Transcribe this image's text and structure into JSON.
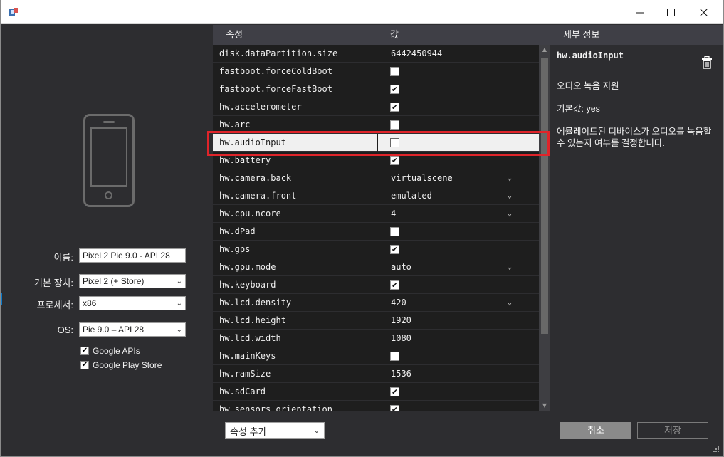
{
  "window": {
    "minimize_glyph": "—",
    "maximize_glyph": "☐",
    "close_glyph": "✕"
  },
  "form": {
    "name_label": "이름:",
    "name_value": "Pixel 2 Pie 9.0 - API 28",
    "base_device_label": "기본 장치:",
    "base_device_value": "Pixel 2 (+ Store)",
    "processor_label": "프로세서:",
    "processor_value": "x86",
    "os_label": "OS:",
    "os_value": "Pie 9.0 – API 28",
    "google_apis_label": "Google APIs",
    "google_play_label": "Google Play Store",
    "google_apis_checked": true,
    "google_play_checked": true
  },
  "grid": {
    "col_property": "속성",
    "col_value": "값",
    "rows": [
      {
        "name": "disk.dataPartition.size",
        "type": "text",
        "value": "6442450944"
      },
      {
        "name": "fastboot.forceColdBoot",
        "type": "check",
        "checked": false
      },
      {
        "name": "fastboot.forceFastBoot",
        "type": "check",
        "checked": true
      },
      {
        "name": "hw.accelerometer",
        "type": "check",
        "checked": true
      },
      {
        "name": "hw.arc",
        "type": "check",
        "checked": false
      },
      {
        "name": "hw.audioInput",
        "type": "check",
        "checked": false,
        "selected": true
      },
      {
        "name": "hw.battery",
        "type": "check",
        "checked": true
      },
      {
        "name": "hw.camera.back",
        "type": "select",
        "value": "virtualscene"
      },
      {
        "name": "hw.camera.front",
        "type": "select",
        "value": "emulated"
      },
      {
        "name": "hw.cpu.ncore",
        "type": "select",
        "value": "4"
      },
      {
        "name": "hw.dPad",
        "type": "check",
        "checked": false
      },
      {
        "name": "hw.gps",
        "type": "check",
        "checked": true
      },
      {
        "name": "hw.gpu.mode",
        "type": "select",
        "value": "auto"
      },
      {
        "name": "hw.keyboard",
        "type": "check",
        "checked": true
      },
      {
        "name": "hw.lcd.density",
        "type": "select",
        "value": "420"
      },
      {
        "name": "hw.lcd.height",
        "type": "text",
        "value": "1920"
      },
      {
        "name": "hw.lcd.width",
        "type": "text",
        "value": "1080"
      },
      {
        "name": "hw.mainKeys",
        "type": "check",
        "checked": false
      },
      {
        "name": "hw.ramSize",
        "type": "text",
        "value": "1536"
      },
      {
        "name": "hw.sdCard",
        "type": "check",
        "checked": true
      },
      {
        "name": "hw.sensors.orientation",
        "type": "check",
        "checked": true
      }
    ]
  },
  "details": {
    "header": "세부 정보",
    "title": "hw.audioInput",
    "summary": "오디오 녹음 지원",
    "default": "기본값: yes",
    "description": "에뮬레이트된 디바이스가 오디오를 녹음할 수 있는지 여부를 결정합니다."
  },
  "bottom": {
    "add_property": "속성 추가",
    "cancel": "취소",
    "save": "저장"
  },
  "colors": {
    "highlight": "#e0242a",
    "grid_bg": "#1e1e1e",
    "pane_bg": "#2d2d30",
    "header_bg": "#3f3f46"
  }
}
